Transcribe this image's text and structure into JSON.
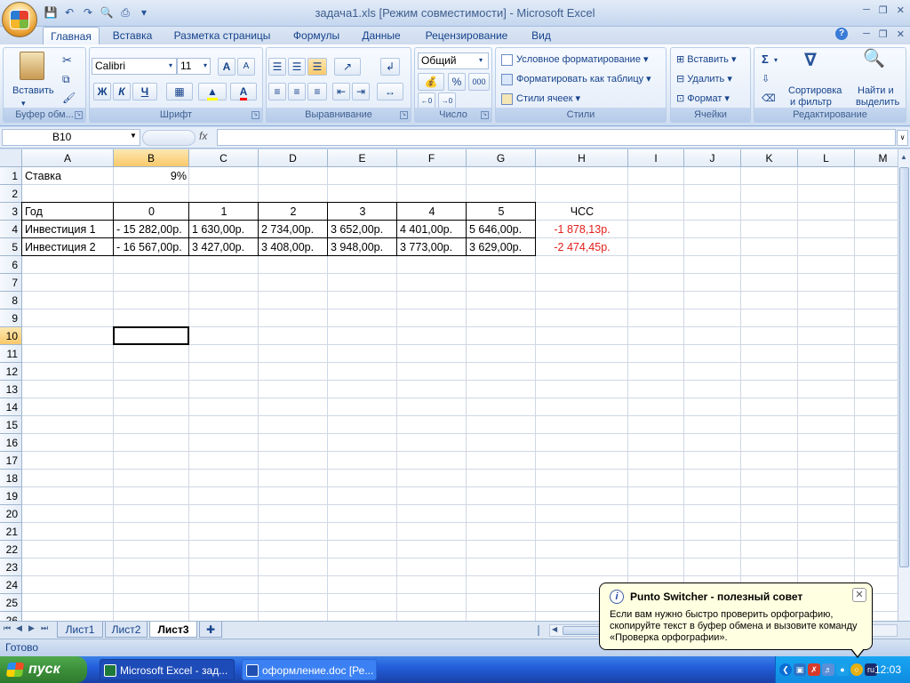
{
  "window": {
    "title": "задача1.xls  [Режим совместимости] - Microsoft Excel"
  },
  "tabs": [
    "Главная",
    "Вставка",
    "Разметка страницы",
    "Формулы",
    "Данные",
    "Рецензирование",
    "Вид"
  ],
  "ribbon": {
    "clipboard": {
      "label": "Буфер обм...",
      "paste": "Вставить"
    },
    "font": {
      "label": "Шрифт",
      "name": "Calibri",
      "size": "11",
      "bold": "Ж",
      "italic": "К",
      "underline": "Ч",
      "grow": "A",
      "shrink": "A"
    },
    "alignment": {
      "label": "Выравнивание"
    },
    "number": {
      "label": "Число",
      "format": "Общий",
      "percent": "%",
      "thousands": "000"
    },
    "styles": {
      "label": "Стили",
      "conditional": "Условное форматирование",
      "table": "Форматировать как таблицу",
      "cell_styles": "Стили ячеек"
    },
    "cells": {
      "label": "Ячейки",
      "insert": "Вставить",
      "delete": "Удалить",
      "format": "Формат"
    },
    "editing": {
      "label": "Редактирование",
      "sum": "Σ",
      "sort1": "Сортировка",
      "sort2": "и фильтр",
      "find1": "Найти и",
      "find2": "выделить"
    }
  },
  "formula_bar": {
    "name_box": "B10",
    "fx": "fx",
    "content": ""
  },
  "columns": [
    "A",
    "B",
    "C",
    "D",
    "E",
    "F",
    "G",
    "H",
    "I",
    "J",
    "K",
    "L",
    "M"
  ],
  "rows": [
    "1",
    "2",
    "3",
    "4",
    "5",
    "6",
    "7",
    "8",
    "9",
    "10",
    "11",
    "12",
    "13",
    "14",
    "15",
    "16",
    "17",
    "18",
    "19",
    "20",
    "21",
    "22",
    "23",
    "24",
    "25",
    "26"
  ],
  "cells": {
    "A1": "Ставка",
    "B1": "9%",
    "A3": "Год",
    "B3": "0",
    "C3": "1",
    "D3": "2",
    "E3": "3",
    "F3": "4",
    "G3": "5",
    "H3": "ЧСС",
    "A4": "Инвестиция 1",
    "B4": "- 15 282,00р.",
    "C4": "1 630,00р.",
    "D4": "2 734,00р.",
    "E4": "3 652,00р.",
    "F4": "4 401,00р.",
    "G4": "5 646,00р.",
    "H4": "-1 878,13р.",
    "A5": "Инвестиция 2",
    "B5": "- 16 567,00р.",
    "C5": "3 427,00р.",
    "D5": "3 408,00р.",
    "E5": "3 948,00р.",
    "F5": "3 773,00р.",
    "G5": "3 629,00р.",
    "H5": "-2 474,45р."
  },
  "sheets": [
    "Лист1",
    "Лист2",
    "Лист3"
  ],
  "status": "Готово",
  "taskbar": {
    "start": "пуск",
    "task1": "Microsoft Excel - зад...",
    "task2": "оформление.doc [Ре...",
    "clock": "12:03"
  },
  "balloon": {
    "title": "Punto Switcher - полезный совет",
    "text": "Если вам нужно быстро проверить орфографию, скопируйте текст в буфер обмена и вызовите команду «Проверка орфографии»."
  },
  "colors": {
    "negative": "#e0201b",
    "ribbon_text": "#15428b",
    "selection_header": "#f9c96b"
  }
}
